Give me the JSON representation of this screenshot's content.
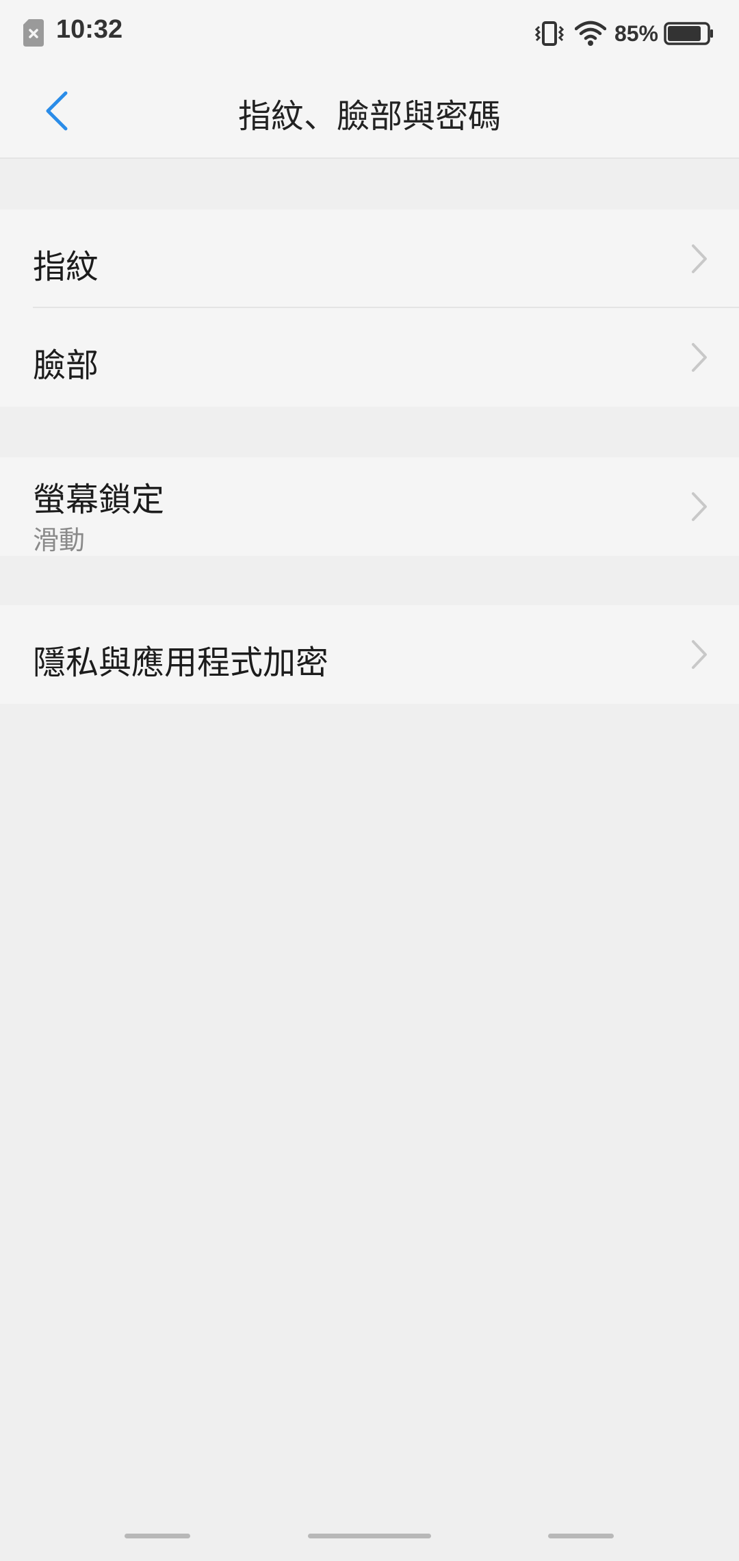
{
  "status_bar": {
    "time": "10:32",
    "battery_percent": "85%",
    "battery_level": 0.85,
    "icons": [
      "sim-missing-icon",
      "vibrate-icon",
      "wifi-icon",
      "battery-icon"
    ]
  },
  "header": {
    "title": "指紋、臉部與密碼",
    "back_icon": "back-arrow-icon"
  },
  "settings": {
    "fingerprint": {
      "label": "指紋"
    },
    "face": {
      "label": "臉部"
    },
    "screen_lock": {
      "label": "螢幕鎖定",
      "value": "滑動"
    },
    "privacy": {
      "label": "隱私與應用程式加密"
    }
  },
  "colors": {
    "accent": "#2a8ce8",
    "background": "#efefef",
    "surface": "#f5f5f5",
    "text_primary": "#1c1c1c",
    "text_secondary": "#8a8a8a",
    "chevron": "#c8c8c8"
  }
}
